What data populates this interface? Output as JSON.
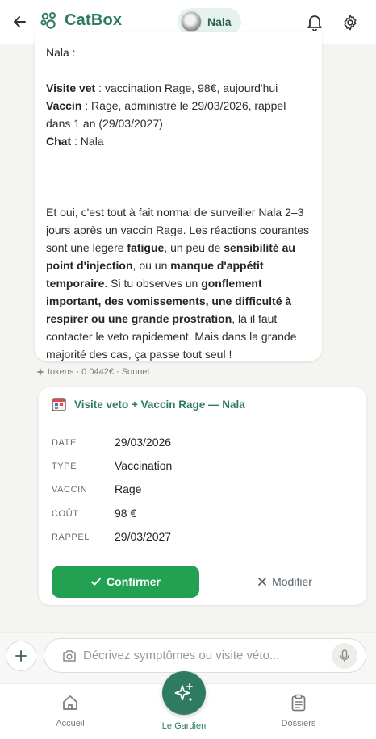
{
  "header": {
    "app_name": "CatBox",
    "pet_name": "Nala",
    "accent": "#2e7a63"
  },
  "message": {
    "line1": "Nala :",
    "visite_label": "Visite vet",
    "visite_text": " : vaccination Rage, 98€, aujourd'hui",
    "vaccin_label": "Vaccin",
    "vaccin_text": " : Rage, administré le 29/03/2026, rappel dans 1 an (29/03/2027)",
    "chat_label": "Chat",
    "chat_text": " : Nala",
    "p2_a": "Et oui, c'est tout à fait normal de surveiller Nala 2–3 jours après un vaccin Rage. Les réactions courantes sont une légère ",
    "p2_b": "fatigue",
    "p2_c": ", un peu de ",
    "p2_d": "sensibilité au point d'injection",
    "p2_e": ", ou un ",
    "p2_f": "manque d'appétit temporaire",
    "p2_g": ". Si tu observes un ",
    "p2_h": "gonflement important, des vomissements, une difficulté à respirer ou une grande prostration",
    "p2_i": ", là il faut contacter le veto rapidement. Mais dans la grande majorité des cas, ça passe tout seul !",
    "meta": "tokens · 0.0442€ · Sonnet"
  },
  "card": {
    "title": "Visite veto + Vaccin Rage — Nala",
    "fields": [
      {
        "label": "DATE",
        "value": "29/03/2026"
      },
      {
        "label": "TYPE",
        "value": "Vaccination"
      },
      {
        "label": "VACCIN",
        "value": "Rage"
      },
      {
        "label": "COÛT",
        "value": "98 €"
      },
      {
        "label": "RAPPEL",
        "value": "29/03/2027"
      }
    ],
    "confirm_label": "Confirmer",
    "modify_label": "Modifier",
    "confirm_color": "#23a153"
  },
  "input": {
    "placeholder": "Décrivez symptômes ou visite véto...",
    "value": ""
  },
  "nav": {
    "items": [
      {
        "label": "Accueil",
        "icon": "home-icon"
      },
      {
        "label": "Le Gardien",
        "icon": "sparkles-icon"
      },
      {
        "label": "Dossiers",
        "icon": "clipboard-icon"
      }
    ]
  }
}
